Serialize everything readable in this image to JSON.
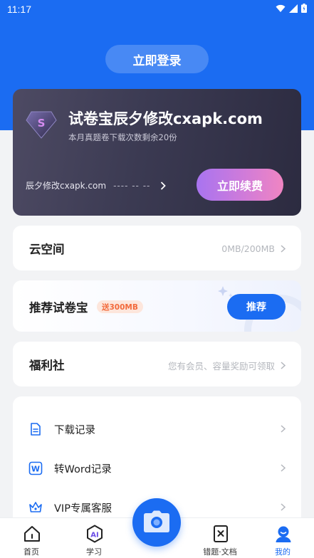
{
  "status_bar": {
    "time": "11:17"
  },
  "header": {
    "login_label": "立即登录"
  },
  "vip_card": {
    "title": "试卷宝辰夕修改cxapk.com",
    "subtitle": "本月真题卷下载次数剩余20份",
    "link_text": "辰夕修改cxapk.com",
    "link_dashes": "---- -- --",
    "renew_label": "立即续费"
  },
  "cloud": {
    "title": "云空间",
    "usage": "0MB/200MB"
  },
  "recommend": {
    "title": "推荐试卷宝",
    "badge": "送300MB",
    "button": "推荐"
  },
  "welfare": {
    "title": "福利社",
    "hint": "您有会员、容量奖励可领取"
  },
  "menu": {
    "items": [
      {
        "label": "下载记录",
        "icon": "download-record-icon"
      },
      {
        "label": "转Word记录",
        "icon": "word-icon"
      },
      {
        "label": "VIP专属客服",
        "icon": "crown-icon"
      }
    ]
  },
  "tab_bar": {
    "tabs": [
      {
        "label": "首页",
        "icon": "home-icon"
      },
      {
        "label": "学习",
        "icon": "ai-icon"
      },
      {
        "label": "错题·文档",
        "icon": "wrong-question-icon"
      },
      {
        "label": "我的",
        "icon": "profile-icon"
      }
    ],
    "active": "我的",
    "center_icon": "camera-icon"
  },
  "colors": {
    "accent": "#1b6cf2",
    "badge_text": "#f26a3c"
  }
}
